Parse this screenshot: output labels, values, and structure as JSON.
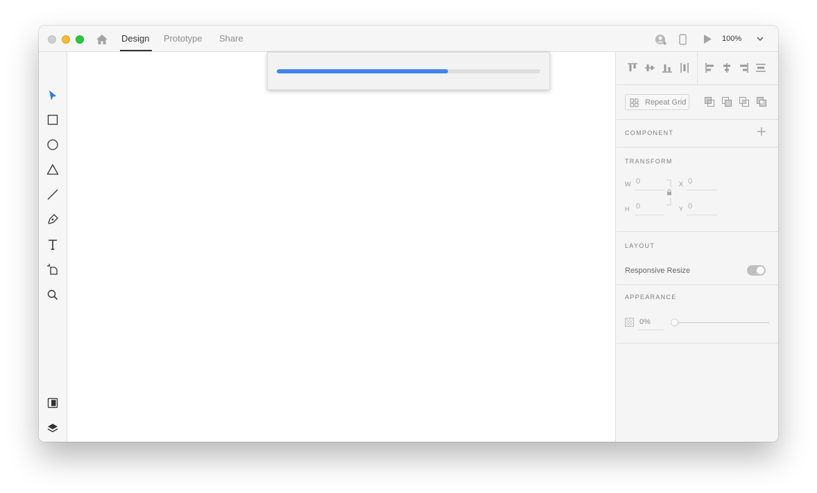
{
  "titlebar": {
    "tabs": [
      {
        "label": "Design",
        "active": true
      },
      {
        "label": "Prototype",
        "active": false
      },
      {
        "label": "Share",
        "active": false
      }
    ],
    "zoom_label": "100%",
    "icons": [
      "home-icon",
      "user-add-icon",
      "mobile-preview-icon",
      "play-icon",
      "chevron-down-icon"
    ]
  },
  "toolbar": {
    "tools": [
      "select-icon",
      "rectangle-icon",
      "ellipse-icon",
      "polygon-icon",
      "line-icon",
      "pen-icon",
      "text-icon",
      "artboard-icon",
      "zoom-icon"
    ],
    "bottom_tools": [
      "assets-icon",
      "layers-icon",
      "plugins-icon"
    ],
    "active_tool": "select-icon"
  },
  "progress": {
    "fraction": 0.65,
    "color": "#3f86eb"
  },
  "panel": {
    "repeat_grid_label": "Repeat Grid",
    "component": {
      "title": "COMPONENT"
    },
    "transform": {
      "title": "TRANSFORM",
      "w_label": "W",
      "w_value": "0",
      "h_label": "H",
      "h_value": "0",
      "x_label": "X",
      "x_value": "0",
      "y_label": "Y",
      "y_value": "0"
    },
    "layout": {
      "title": "LAYOUT",
      "responsive_label": "Responsive Resize",
      "responsive_on": true
    },
    "appearance": {
      "title": "APPEARANCE",
      "opacity_value": "0%"
    }
  },
  "colors": {
    "accent": "#3f86eb",
    "select_tool": "#2d7be5"
  }
}
